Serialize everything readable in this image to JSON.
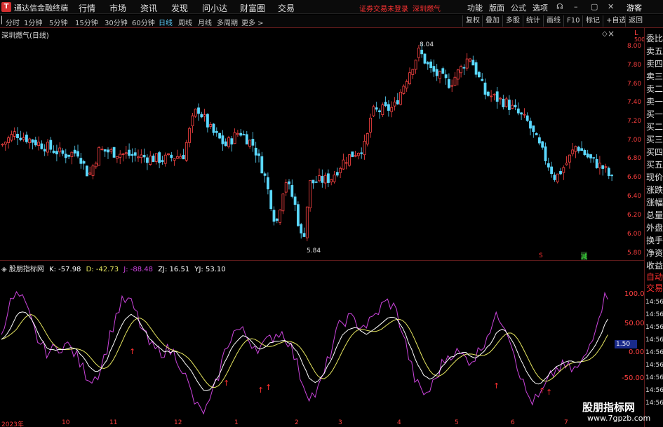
{
  "titlebar": {
    "app_name": "通达信金融终端",
    "menus": [
      "行情",
      "市场",
      "资讯",
      "发现",
      "问小达",
      "财富圈",
      "交易"
    ],
    "alert": "证券交易未登录",
    "stock": "深圳燃气",
    "right_items": [
      "功能",
      "版面",
      "公式",
      "选项"
    ],
    "guest": "游客"
  },
  "toolbar": {
    "periods": [
      "分时",
      "1分钟",
      "5分钟",
      "15分钟",
      "30分钟",
      "60分钟",
      "日线",
      "周线",
      "月线",
      "多周期",
      "更多 >"
    ],
    "active": "日线",
    "right_buttons": [
      "复权",
      "叠加",
      "多股",
      "统计",
      "画线",
      "F10",
      "标记",
      "+自选",
      "返回"
    ]
  },
  "chart": {
    "title": "深圳燃气(日线)",
    "high_label": "8.04",
    "low_label": "5.84",
    "marker_s": "S",
    "marker_b": "减",
    "price_ticks": [
      "8.00",
      "7.80",
      "7.60",
      "7.40",
      "7.20",
      "7.00",
      "6.80",
      "6.60",
      "6.40",
      "6.20",
      "6.00",
      "5.80"
    ],
    "axis_top": "L",
    "axis_top2": "500"
  },
  "indicator": {
    "name": "股朋指标网",
    "K": "K: -57.98",
    "D": "D: -42.73",
    "J": "J: -88.48",
    "ZJ": "ZJ: 16.51",
    "YJ": "YJ: 53.10",
    "ticks": [
      "100.0",
      "50.00",
      "0.00",
      "-50.00"
    ],
    "badge": "1.50",
    "right_labels": [
      "14:56",
      "14:56",
      "14:56",
      "14:56",
      "14:56",
      "14:56",
      "14:56",
      "14:56",
      "14:56"
    ]
  },
  "right_panel": {
    "items": [
      "委比",
      "卖五",
      "卖四",
      "卖三",
      "卖二",
      "卖一",
      "买一",
      "买二",
      "买三",
      "买四",
      "买五",
      "现价",
      "涨跌",
      "涨幅",
      "总量",
      "外盘",
      "换手",
      "净资",
      "收益",
      "自动",
      "交易"
    ]
  },
  "dates": [
    "2023年",
    "10",
    "11",
    "12",
    "1",
    "2",
    "3",
    "4",
    "5",
    "6",
    "7"
  ],
  "watermark": {
    "title": "股朋指标网",
    "url": "www.7gpzb.com"
  },
  "colors": {
    "up": "#ff4444",
    "down": "#5ad8ff",
    "k": "#ffffff",
    "d": "#e8e860",
    "j": "#cc44dd",
    "border": "#5a1a1a"
  }
}
